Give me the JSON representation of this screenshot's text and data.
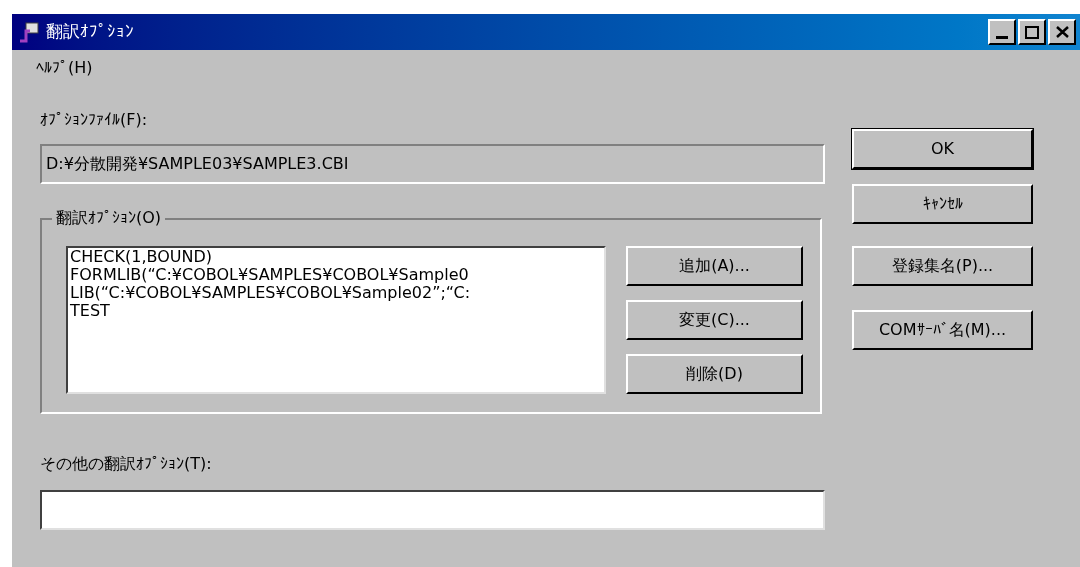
{
  "window": {
    "title": "翻訳ｵﾌﾟｼｮﾝ"
  },
  "menu": [
    {
      "label": "ﾍﾙﾌﾟ(H)"
    }
  ],
  "option_file": {
    "label": "ｵﾌﾟｼｮﾝﾌｧｲﾙ(F):",
    "value": "D:¥分散開発¥SAMPLE03¥SAMPLE3.CBI"
  },
  "options_group": {
    "title": "翻訳ｵﾌﾟｼｮﾝ(O)",
    "items": [
      "CHECK(1,BOUND)",
      "FORMLIB(“C:¥COBOL¥SAMPLES¥COBOL¥Sample0",
      "LIB(“C:¥COBOL¥SAMPLES¥COBOL¥Sample02”;“C:",
      "TEST"
    ],
    "buttons": [
      "追加(A)...",
      "変更(C)...",
      "削除(D)"
    ]
  },
  "other_options": {
    "label": "その他の翻訳ｵﾌﾟｼｮﾝ(T):"
  },
  "side_buttons": [
    {
      "label": "OK",
      "default": true
    },
    {
      "label": "ｷｬﾝｾﾙ",
      "default": false
    },
    {
      "label": "登録集名(P)...",
      "default": false
    },
    {
      "label": "COMｻｰﾊﾞ名(M)...",
      "default": false
    }
  ]
}
